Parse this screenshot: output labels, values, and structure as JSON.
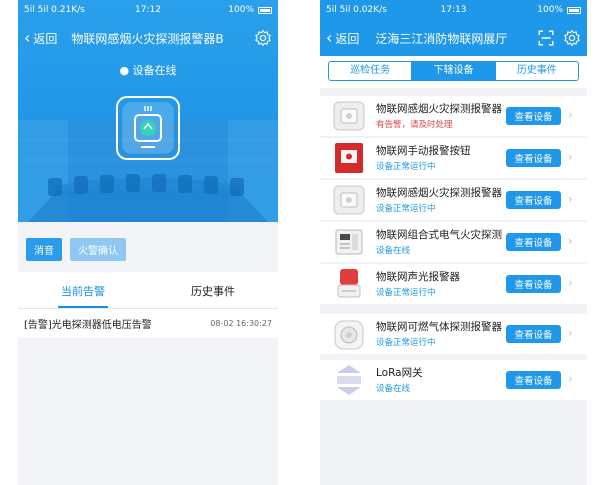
{
  "left": {
    "status": {
      "left": "5il 5il 0.21K/s",
      "time": "17:12",
      "battery": "100%"
    },
    "nav": {
      "back": "返回",
      "title": "物联网感烟火灾探测报警器B"
    },
    "online": "设备在线",
    "buttons": {
      "mute": "消音",
      "confirm": "火警确认"
    },
    "tabs": [
      "当前告警",
      "历史事件"
    ],
    "alarm": {
      "text": "[告警]光电探测器低电压告警",
      "time": "08-02 16:30:27"
    }
  },
  "right": {
    "status": {
      "left": "5il 5il 0.02K/s",
      "time": "17:13",
      "battery": "100%"
    },
    "nav": {
      "back": "返回",
      "title": "泛海三江消防物联网展厅"
    },
    "segments": [
      "巡检任务",
      "下辖设备",
      "历史事件"
    ],
    "view_label": "查看设备",
    "devices": [
      {
        "name": "物联网感烟火灾探测报警器",
        "status": "有告警，请及时处理",
        "warn": true
      },
      {
        "name": "物联网手动报警按钮",
        "status": "设备正常运行中",
        "warn": false
      },
      {
        "name": "物联网感烟火灾探测报警器",
        "status": "设备正常运行中",
        "warn": false
      },
      {
        "name": "物联网组合式电气火灾探测",
        "status": "设备在线",
        "warn": false
      },
      {
        "name": "物联网声光报警器",
        "status": "设备正常运行中",
        "warn": false
      },
      {
        "name": "物联网可燃气体探测报警器",
        "status": "设备正常运行中",
        "warn": false
      },
      {
        "name": "LoRa网关",
        "status": "设备在线",
        "warn": false
      }
    ]
  }
}
